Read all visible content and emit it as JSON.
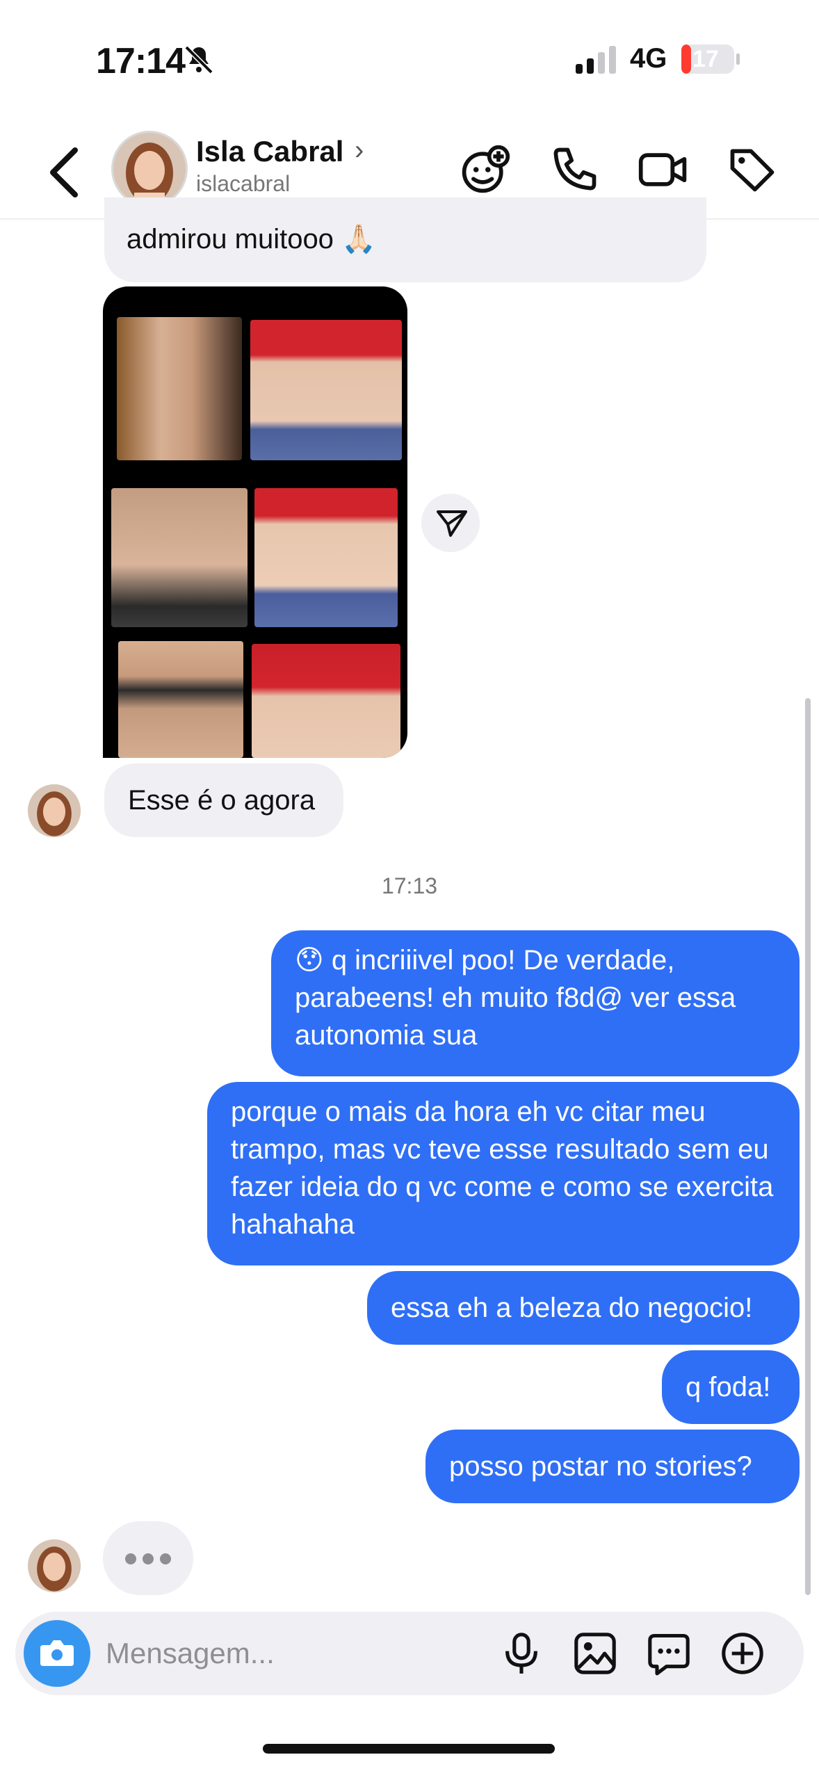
{
  "status_bar": {
    "time": "17:14",
    "network": "4G",
    "battery": "17"
  },
  "header": {
    "name": "Isla Cabral",
    "username": "islacabral",
    "name_chevron": "›"
  },
  "messages": {
    "top_partial": "admirou muitooo 🙏🏻",
    "incoming_agora": "Esse é o agora",
    "time_separator": "17:13",
    "outgoing": [
      "😯 q incriiivel poo! De verdade, parabeens! eh muito f8d@ ver essa autonomia sua",
      "porque o mais da hora eh vc citar meu trampo, mas vc teve esse resultado sem eu fazer ideia do q vc come e como se exercita hahahaha",
      "essa eh a beleza do negocio!",
      "q foda!",
      "posso postar no stories?"
    ]
  },
  "composer": {
    "placeholder": "Mensagem..."
  },
  "colors": {
    "outgoing_bubble": "#2f6ff6",
    "incoming_bubble": "#efeff4",
    "camera_button": "#3797f0"
  },
  "icons": [
    "bell-off-icon",
    "signal-icon",
    "battery-icon",
    "back-chevron-icon",
    "effects-icon",
    "phone-icon",
    "video-icon",
    "tag-icon",
    "share-icon",
    "camera-icon",
    "mic-icon",
    "gallery-icon",
    "sticker-icon",
    "plus-icon"
  ]
}
